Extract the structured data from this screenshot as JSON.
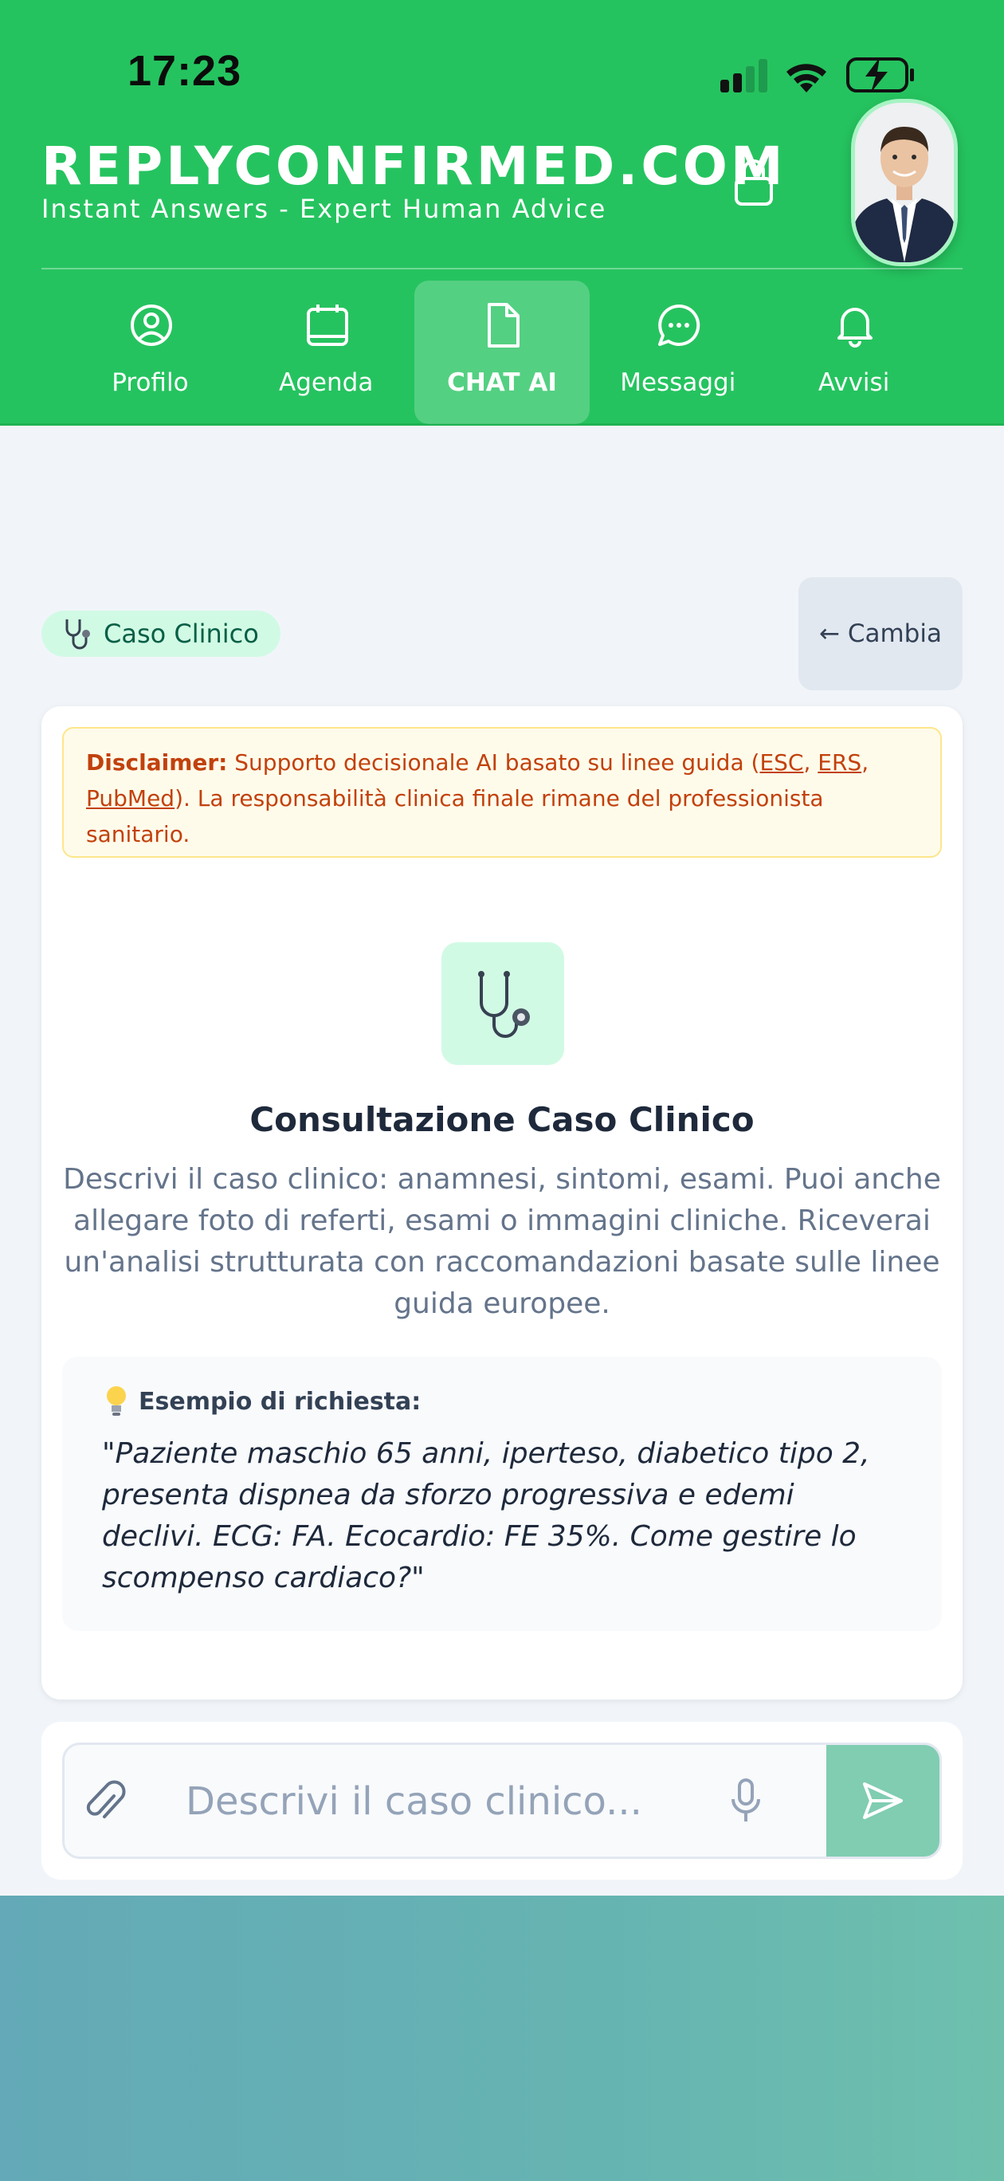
{
  "status_bar": {
    "time": "17:23"
  },
  "header": {
    "brand_title": "REPLYCONFIRMED.COM",
    "brand_subtitle": "Instant Answers - Expert Human Advice"
  },
  "nav": {
    "items": [
      {
        "label": "Profilo",
        "icon": "user-circle-icon"
      },
      {
        "label": "Agenda",
        "icon": "calendar-icon"
      },
      {
        "label": "CHAT AI",
        "icon": "document-icon",
        "active": true
      },
      {
        "label": "Messaggi",
        "icon": "chat-bubble-icon"
      },
      {
        "label": "Avvisi",
        "icon": "bell-icon"
      }
    ]
  },
  "mode": {
    "chip_label": "Caso Clinico",
    "chip_icon": "stethoscope-icon",
    "change_label": "← Cambia"
  },
  "disclaimer": {
    "label": "Disclaimer:",
    "text_before": " Supporto decisionale AI basato su linee guida (",
    "link_esc": "ESC",
    "sep1": ", ",
    "link_ers": "ERS",
    "sep2": ", ",
    "link_pubmed": "PubMed",
    "text_after": "). La responsabilità clinica finale rimane del professionista sanitario."
  },
  "empty_state": {
    "icon": "stethoscope-icon",
    "title": "Consultazione Caso Clinico",
    "description": "Descrivi il caso clinico: anamnesi, sintomi, esami. Puoi anche allegare foto di referti, esami o immagini cliniche. Riceverai un'analisi strutturata con raccomandazioni basate sulle linee guida europee."
  },
  "example": {
    "icon": "lightbulb-icon",
    "heading": "Esempio di richiesta:",
    "text": "\"Paziente maschio 65 anni, iperteso, diabetico tipo 2, presenta dispnea da sforzo progressiva e edemi declivi. ECG: FA. Ecocardio: FE 35%. Come gestire lo scompenso cardiaco?\""
  },
  "composer": {
    "placeholder": "Descrivi il caso clinico...",
    "value": ""
  },
  "colors": {
    "header_green": "#25c35f",
    "send_button": "#80cdb1",
    "chip_bg": "#d1fae5",
    "disclaimer_text": "#c2410c"
  }
}
